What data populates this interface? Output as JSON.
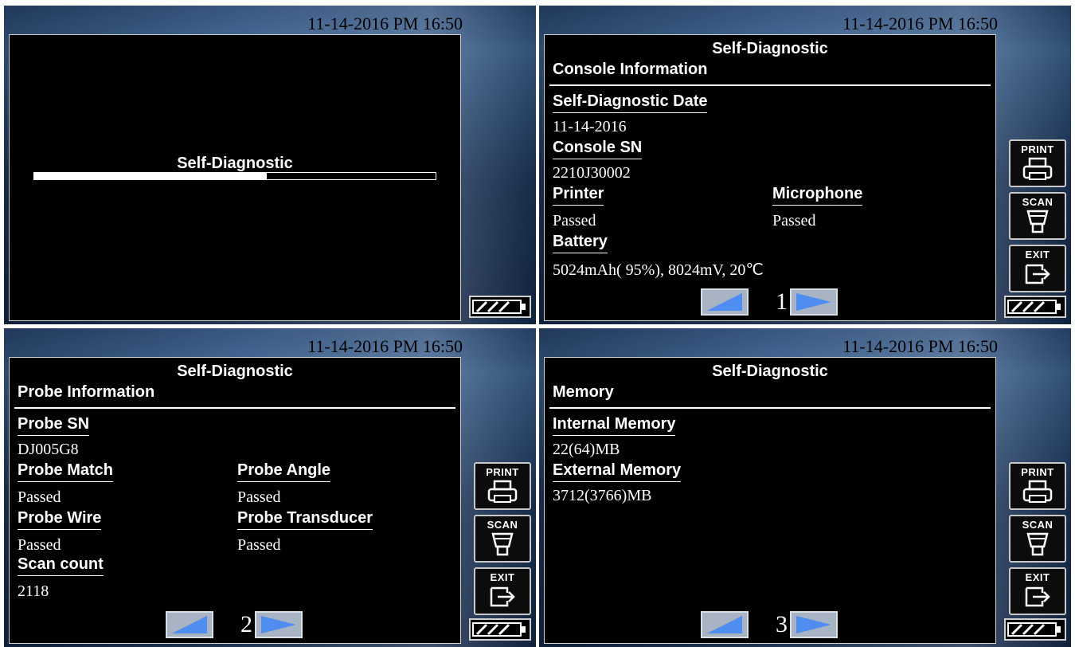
{
  "datetime": "11-14-2016 PM 16:50",
  "panels": {
    "loading": {
      "progress_label": "Self-Diagnostic",
      "progress_fraction": 0.58
    },
    "console": {
      "title": "Self-Diagnostic",
      "section": "Console Information",
      "date_label": "Self-Diagnostic Date",
      "date_value": "11-14-2016",
      "sn_label": "Console SN",
      "sn_value": "2210J30002",
      "printer_label": "Printer",
      "printer_value": "Passed",
      "microphone_label": "Microphone",
      "microphone_value": "Passed",
      "battery_label": "Battery",
      "battery_value": "5024mAh( 95%), 8024mV, 20℃",
      "page": "1"
    },
    "probe": {
      "title": "Self-Diagnostic",
      "section": "Probe Information",
      "sn_label": "Probe SN",
      "sn_value": "DJ005G8",
      "match_label": "Probe Match",
      "match_value": "Passed",
      "angle_label": "Probe Angle",
      "angle_value": "Passed",
      "wire_label": "Probe Wire",
      "wire_value": "Passed",
      "transducer_label": "Probe Transducer",
      "transducer_value": "Passed",
      "scan_count_label": "Scan count",
      "scan_count_value": "2118",
      "page": "2"
    },
    "memory": {
      "title": "Self-Diagnostic",
      "section": "Memory",
      "internal_label": "Internal Memory",
      "internal_value": "22(64)MB",
      "external_label": "External Memory",
      "external_value": "3712(3766)MB",
      "page": "3"
    }
  },
  "side_buttons": {
    "print": "PRINT",
    "scan": "SCAN",
    "exit": "EXIT"
  },
  "icons": {
    "print": "printer-icon",
    "scan": "scan-probe-icon",
    "exit": "exit-door-icon",
    "battery": "battery-icon",
    "prev": "left-triangle-icon",
    "next": "right-triangle-icon"
  },
  "colors": {
    "screen_bg": "#000000",
    "panel_bg": "#2c4c78",
    "text": "#ffffff",
    "arrow_bg": "#a8b4c4"
  }
}
